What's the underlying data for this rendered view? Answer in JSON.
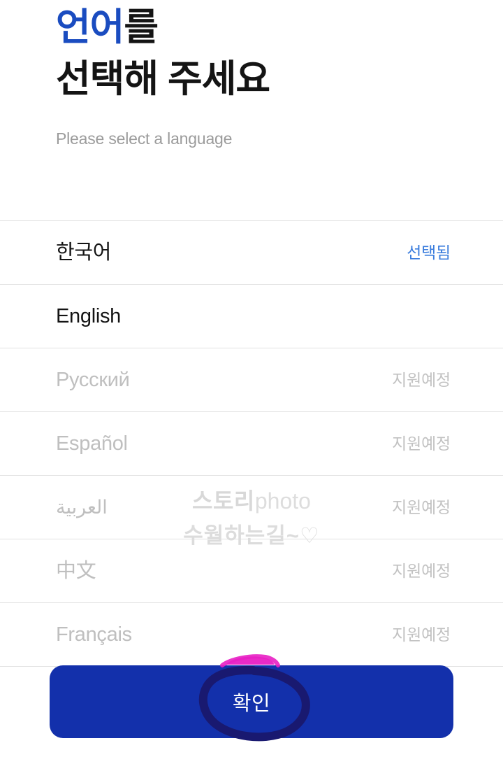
{
  "header": {
    "title_accent": "언어",
    "title_rest": "를",
    "title_line2": "선택해 주세요",
    "subtitle": "Please select a language"
  },
  "language_list": [
    {
      "name": "한국어",
      "status": "선택됨",
      "state": "selected"
    },
    {
      "name": "English",
      "status": "",
      "state": "available"
    },
    {
      "name": "Русский",
      "status": "지원예정",
      "state": "disabled"
    },
    {
      "name": "Español",
      "status": "지원예정",
      "state": "disabled"
    },
    {
      "name": "العربية",
      "status": "지원예정",
      "state": "disabled"
    },
    {
      "name": "中文",
      "status": "지원예정",
      "state": "disabled"
    },
    {
      "name": "Français",
      "status": "지원예정",
      "state": "disabled"
    }
  ],
  "watermark": {
    "line1_bold": "스토리",
    "line1_light": "photo",
    "line2": "수월하는길~♡"
  },
  "confirm_button": {
    "label": "확인"
  },
  "annotations": {
    "circle_color": "#191970",
    "highlight_color": "#e81fc4"
  },
  "colors": {
    "title_accent": "#1a4cc0",
    "title_text": "#141414",
    "subtitle_text": "#9b9b9b",
    "selected_status": "#3b7ddd",
    "disabled_text": "#bfbfbf",
    "divider": "#e2e2e2",
    "button_bg": "#1330ab",
    "button_text": "#ffffff",
    "watermark": "#dcdcdc",
    "background": "#ffffff"
  }
}
